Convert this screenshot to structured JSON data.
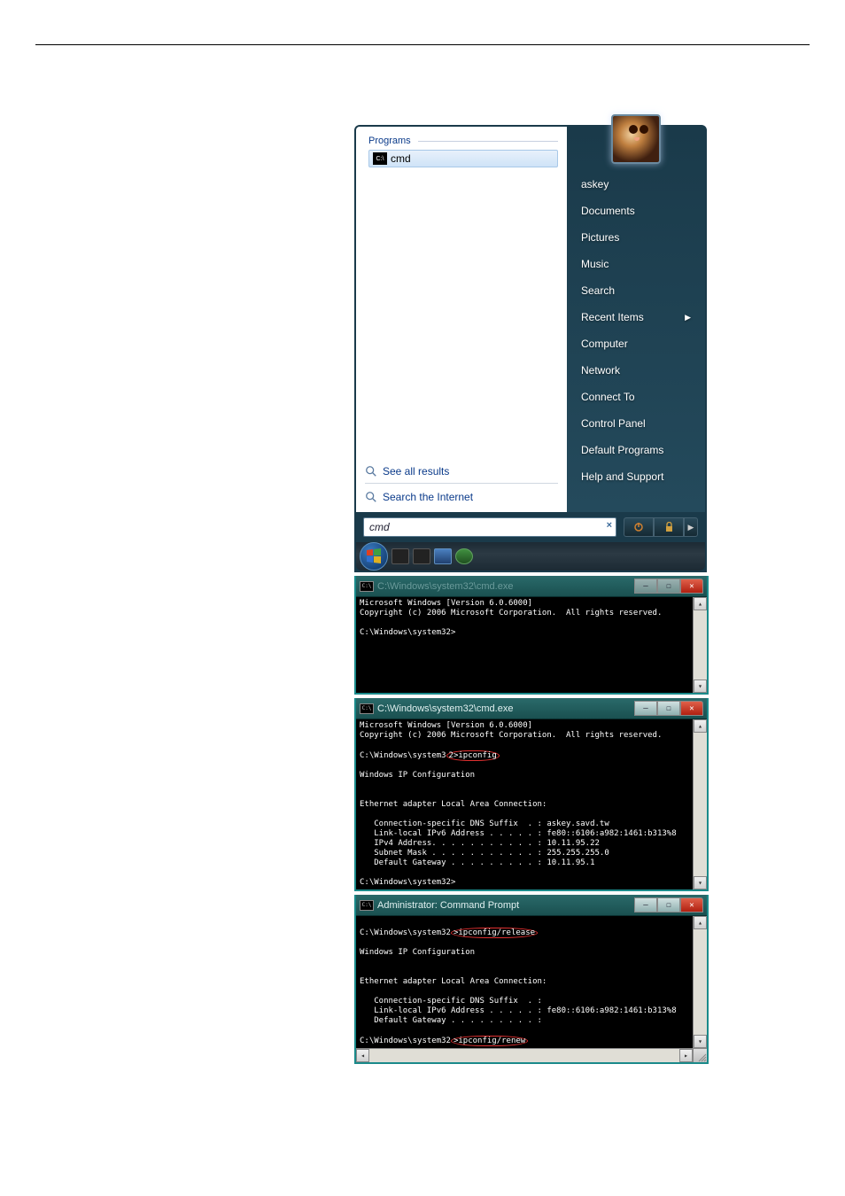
{
  "startmenu": {
    "programs_header": "Programs",
    "program_item": "cmd",
    "see_all": "See all results",
    "search_internet": "Search the Internet",
    "search_value": "cmd",
    "right_user": "askey",
    "right_items": [
      "Documents",
      "Pictures",
      "Music",
      "Search",
      "Recent Items",
      "Computer",
      "Network",
      "Connect To",
      "Control Panel",
      "Default Programs",
      "Help and Support"
    ],
    "submenu_arrow": "▶"
  },
  "cmd1": {
    "title": "C:\\Windows\\system32\\cmd.exe",
    "line1": "Microsoft Windows [Version 6.0.6000]",
    "line2": "Copyright (c) 2006 Microsoft Corporation.  All rights reserved.",
    "prompt": "C:\\Windows\\system32>"
  },
  "cmd2": {
    "title": "C:\\Windows\\system32\\cmd.exe",
    "line1": "Microsoft Windows [Version 6.0.6000]",
    "line2": "Copyright (c) 2006 Microsoft Corporation.  All rights reserved.",
    "prompt_pre": "C:\\Windows\\system3",
    "prompt_cmd": "2>ipconfig",
    "ipconf_hdr": "Windows IP Configuration",
    "adapter_hdr": "Ethernet adapter Local Area Connection:",
    "l_dns": "   Connection-specific DNS Suffix  . : askey.savd.tw",
    "l_ipv6": "   Link-local IPv6 Address . . . . . : fe80::6106:a982:1461:b313%8",
    "l_ipv4": "   IPv4 Address. . . . . . . . . . . : 10.11.95.22",
    "l_mask": "   Subnet Mask . . . . . . . . . . . : 255.255.255.0",
    "l_gw": "   Default Gateway . . . . . . . . . : 10.11.95.1",
    "prompt2": "C:\\Windows\\system32>"
  },
  "cmd3": {
    "title": "Administrator: Command Prompt",
    "prompt1_pre": "C:\\Windows\\system32",
    "prompt1_cmd": ">ipconfig/release",
    "ipconf_hdr": "Windows IP Configuration",
    "adapter_hdr": "Ethernet adapter Local Area Connection:",
    "l_dns": "   Connection-specific DNS Suffix  . :",
    "l_ipv6": "   Link-local IPv6 Address . . . . . : fe80::6106:a982:1461:b313%8",
    "l_gw": "   Default Gateway . . . . . . . . . :",
    "prompt2_pre": "C:\\Windows\\system32",
    "prompt2_cmd": ">ipconfig/renew"
  }
}
